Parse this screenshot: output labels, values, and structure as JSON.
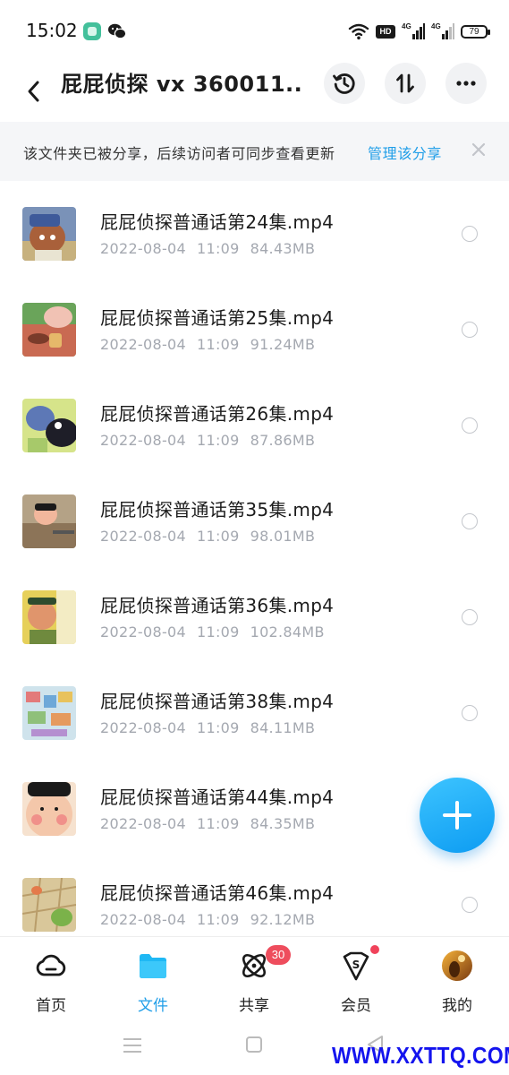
{
  "status_bar": {
    "time": "15:02",
    "hd_label": "HD",
    "signal_1": "4G",
    "signal_2": "4G",
    "battery": "79"
  },
  "header": {
    "title": "屁屁侦探 vx  360011...",
    "history_icon": "history-icon",
    "sort_icon": "sort-icon",
    "more_icon": "more-icon"
  },
  "share_banner": {
    "text": "该文件夹已被分享，后续访问者可同步查看更新",
    "link": "管理该分享"
  },
  "files": [
    {
      "name": "屁屁侦探普通话第24集.mp4",
      "date": "2022-08-04",
      "time": "11:09",
      "size": "84.43MB"
    },
    {
      "name": "屁屁侦探普通话第25集.mp4",
      "date": "2022-08-04",
      "time": "11:09",
      "size": "91.24MB"
    },
    {
      "name": "屁屁侦探普通话第26集.mp4",
      "date": "2022-08-04",
      "time": "11:09",
      "size": "87.86MB"
    },
    {
      "name": "屁屁侦探普通话第35集.mp4",
      "date": "2022-08-04",
      "time": "11:09",
      "size": "98.01MB"
    },
    {
      "name": "屁屁侦探普通话第36集.mp4",
      "date": "2022-08-04",
      "time": "11:09",
      "size": "102.84MB"
    },
    {
      "name": "屁屁侦探普通话第38集.mp4",
      "date": "2022-08-04",
      "time": "11:09",
      "size": "84.11MB"
    },
    {
      "name": "屁屁侦探普通话第44集.mp4",
      "date": "2022-08-04",
      "time": "11:09",
      "size": "84.35MB"
    },
    {
      "name": "屁屁侦探普通话第46集.mp4",
      "date": "2022-08-04",
      "time": "11:09",
      "size": "92.12MB"
    }
  ],
  "bottom_nav": {
    "items": [
      {
        "label": "首页",
        "icon": "cloud-icon"
      },
      {
        "label": "文件",
        "icon": "folder-icon"
      },
      {
        "label": "共享",
        "icon": "atom-icon",
        "badge": "30"
      },
      {
        "label": "会员",
        "icon": "vip-shield-icon"
      },
      {
        "label": "我的",
        "icon": "avatar"
      }
    ]
  },
  "watermark": "WWW.XXTTQ.COM",
  "colors": {
    "accent": "#1f9ee8",
    "badge": "#ee4d5d"
  }
}
